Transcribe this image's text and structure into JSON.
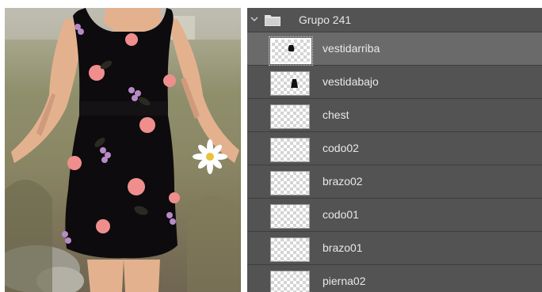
{
  "layers_panel": {
    "group": {
      "name": "Grupo 241",
      "expanded": true
    },
    "layers": [
      {
        "name": "vestidarriba",
        "selected": true,
        "thumb_icon": "dress-top-silhouette"
      },
      {
        "name": "vestidabajo",
        "selected": false,
        "thumb_icon": "dress-bottom-silhouette"
      },
      {
        "name": "chest",
        "selected": false,
        "thumb_icon": ""
      },
      {
        "name": "codo02",
        "selected": false,
        "thumb_icon": ""
      },
      {
        "name": "brazo02",
        "selected": false,
        "thumb_icon": ""
      },
      {
        "name": "codo01",
        "selected": false,
        "thumb_icon": ""
      },
      {
        "name": "brazo01",
        "selected": false,
        "thumb_icon": ""
      },
      {
        "name": "pierna02",
        "selected": false,
        "thumb_icon": ""
      }
    ]
  },
  "canvas": {
    "content": "dress-figure-illustration",
    "colors": {
      "dress": "#0d0b0d",
      "skin": "#e4b18f",
      "flower_pink": "#f08e8e",
      "flower_purple": "#b78ac7"
    }
  },
  "colors": {
    "panel_bg": "#535353",
    "selected_row": "#6a6a6a",
    "text": "#e9e9e9"
  }
}
